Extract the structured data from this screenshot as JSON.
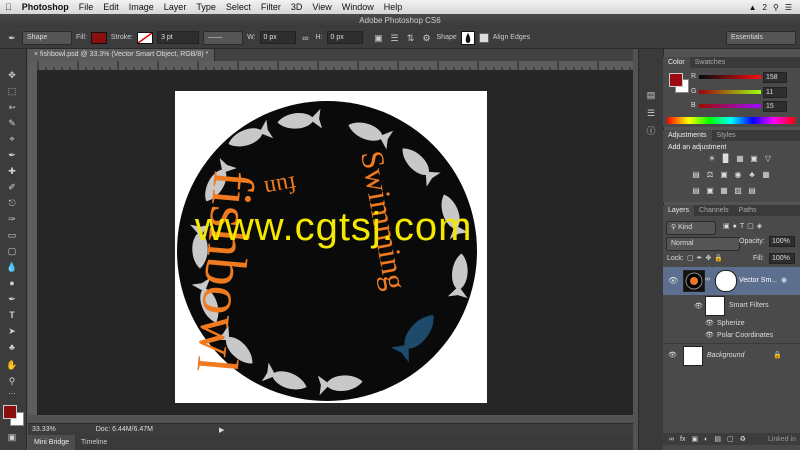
{
  "menubar": {
    "apple": "",
    "items": [
      "Photoshop",
      "File",
      "Edit",
      "Image",
      "Layer",
      "Type",
      "Select",
      "Filter",
      "3D",
      "View",
      "Window",
      "Help"
    ],
    "right_badge": "2"
  },
  "titlebar": {
    "title": "Adobe Photoshop CS6"
  },
  "options": {
    "mode": "Shape",
    "fill_label": "Fill:",
    "stroke_label": "Stroke:",
    "stroke_size": "3 pt",
    "w_label": "W:",
    "w_value": "0 px",
    "h_label": "H:",
    "h_value": "0 px",
    "shape_label": "Shape",
    "align_edges": "Align Edges",
    "workspace": "Essentials",
    "fill_color": "#8b0f0f"
  },
  "document": {
    "tab": "fishbowl.psd @ 33.3% (Vector Smart Object, RGB/8) *",
    "texts": {
      "t1": "fishbowl",
      "t2": "Swimming",
      "t3": "fun"
    },
    "watermark": "www.cgtsj.com"
  },
  "status": {
    "zoom": "33.33%",
    "doc": "Doc: 6.44M/6.47M"
  },
  "bottom_tabs": [
    "Mini Bridge",
    "Timeline"
  ],
  "color_panel": {
    "tabs": [
      "Color",
      "Swatches"
    ],
    "r_label": "R",
    "r_value": "158",
    "g_label": "G",
    "g_value": "11",
    "b_label": "B",
    "b_value": "15"
  },
  "adjustments_panel": {
    "tabs": [
      "Adjustments",
      "Styles"
    ],
    "heading": "Add an adjustment"
  },
  "layers_panel": {
    "tabs": [
      "Layers",
      "Channels",
      "Paths"
    ],
    "kind": "Kind",
    "blend_mode": "Normal",
    "opacity_label": "Opacity:",
    "opacity_value": "100%",
    "lock_label": "Lock:",
    "fill_label": "Fill:",
    "fill_value": "100%",
    "layers": [
      {
        "name": "Vector Sm..."
      },
      {
        "name": "Smart Filters"
      },
      {
        "name": "Spherize"
      },
      {
        "name": "Polar Coordinates"
      },
      {
        "name": "Background"
      }
    ],
    "footer": "Linked in"
  }
}
